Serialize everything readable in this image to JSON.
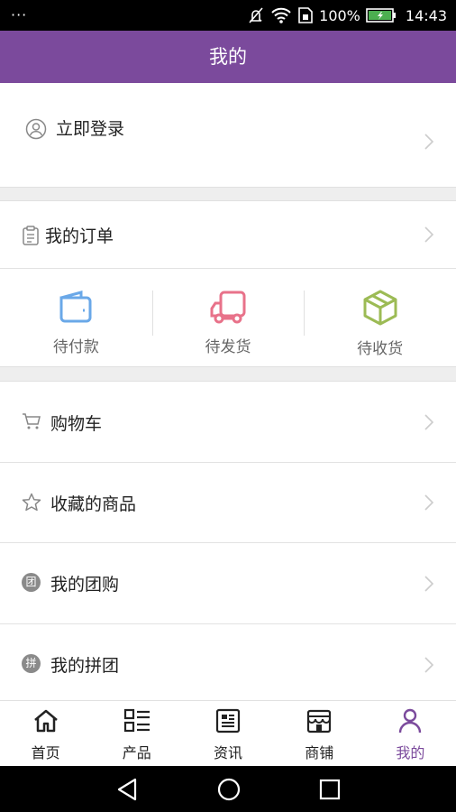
{
  "status_bar": {
    "left_glyph": "···",
    "battery_percent": "100%",
    "time": "14:43",
    "icons": [
      "mute-icon",
      "wifi-icon",
      "sim-icon",
      "battery-icon"
    ]
  },
  "header": {
    "title": "我的"
  },
  "login": {
    "label": "立即登录",
    "icon": "user-icon"
  },
  "orders": {
    "title": "我的订单",
    "icon": "clipboard-icon",
    "items": [
      {
        "label": "待付款",
        "icon": "wallet-icon",
        "color": "#6aa8e8"
      },
      {
        "label": "待发货",
        "icon": "truck-icon",
        "color": "#e8728a"
      },
      {
        "label": "待收货",
        "icon": "package-icon",
        "color": "#9cbb55"
      }
    ]
  },
  "menu": [
    {
      "label": "购物车",
      "icon": "cart-icon"
    },
    {
      "label": "收藏的商品",
      "icon": "star-icon"
    },
    {
      "label": "我的团购",
      "icon": "group-buy-icon",
      "badge": "团"
    },
    {
      "label": "我的拼团",
      "icon": "pin-group-icon",
      "badge": "拼"
    }
  ],
  "tabs": [
    {
      "label": "首页",
      "icon": "home-icon",
      "active": false
    },
    {
      "label": "产品",
      "icon": "list-icon",
      "active": false
    },
    {
      "label": "资讯",
      "icon": "news-icon",
      "active": false
    },
    {
      "label": "商铺",
      "icon": "shop-icon",
      "active": false
    },
    {
      "label": "我的",
      "icon": "profile-icon",
      "active": true
    }
  ],
  "colors": {
    "accent": "#7b4a9c",
    "background": "#eeeeee"
  }
}
